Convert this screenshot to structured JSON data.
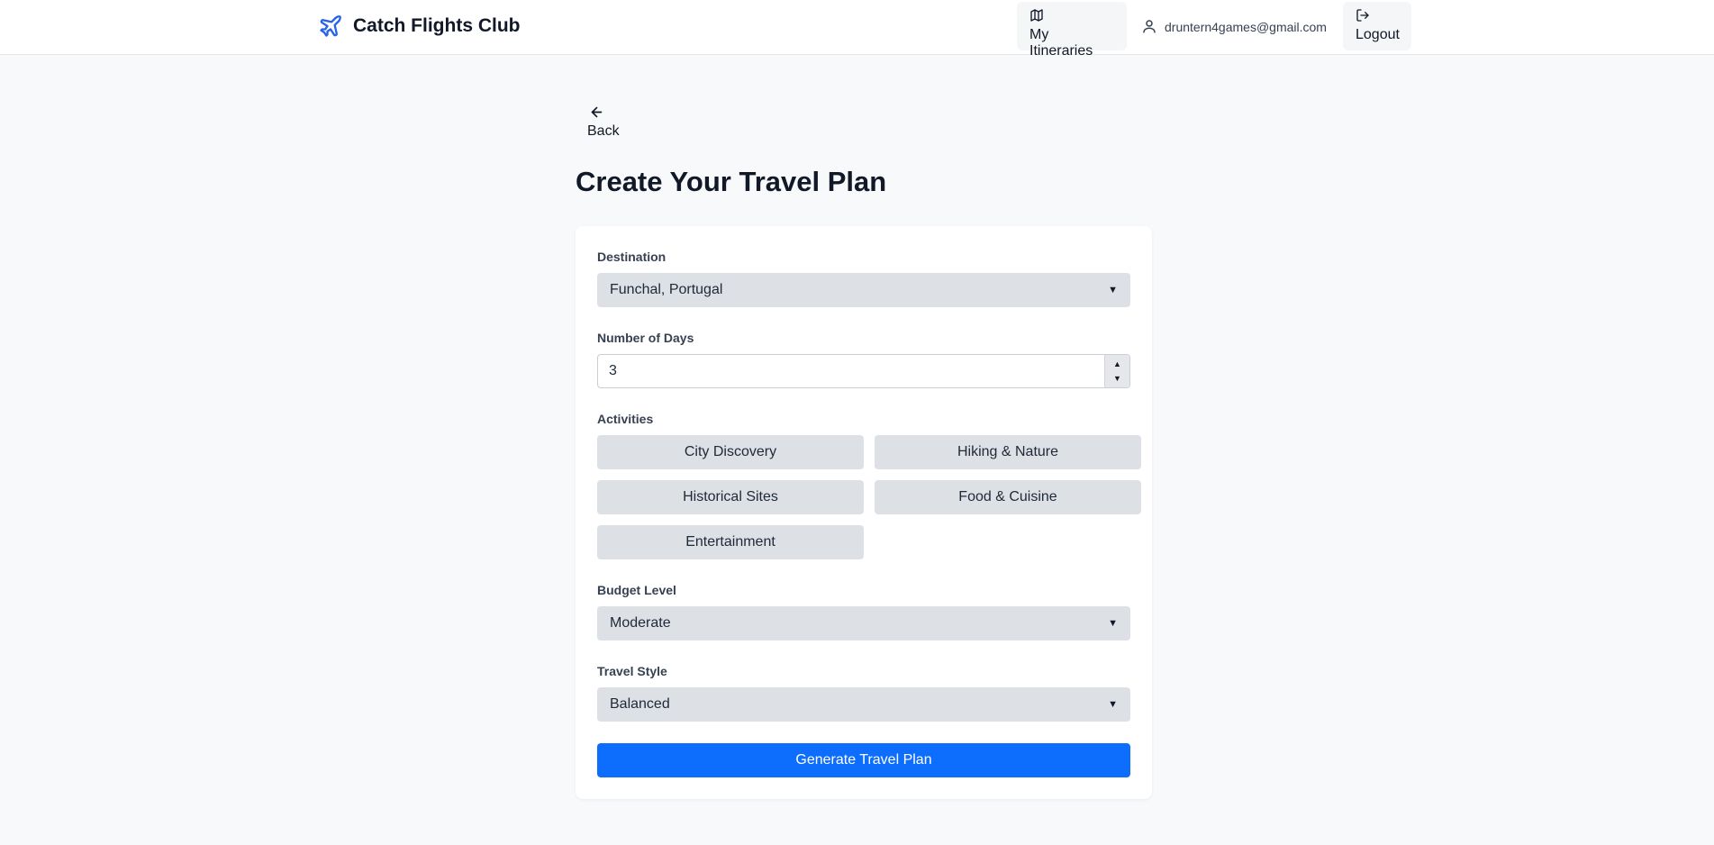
{
  "header": {
    "brand_name": "Catch Flights Club",
    "brand_icon": "plane-icon",
    "itineraries_label": "My Itineraries",
    "itineraries_icon": "map-icon",
    "user_email": "druntern4games@gmail.com",
    "user_icon": "user-icon",
    "logout_label": "Logout",
    "logout_icon": "logout-icon"
  },
  "back": {
    "label": "Back",
    "icon": "arrow-left-icon"
  },
  "page_title": "Create Your Travel Plan",
  "form": {
    "destination": {
      "label": "Destination",
      "value": "Funchal, Portugal"
    },
    "days": {
      "label": "Number of Days",
      "value": "3"
    },
    "activities": {
      "label": "Activities",
      "options": [
        "City Discovery",
        "Hiking & Nature",
        "Historical Sites",
        "Food & Cuisine",
        "Entertainment"
      ]
    },
    "budget": {
      "label": "Budget Level",
      "value": "Moderate"
    },
    "style": {
      "label": "Travel Style",
      "value": "Balanced"
    },
    "submit_label": "Generate Travel Plan"
  },
  "colors": {
    "accent": "#0d6efd",
    "brand_icon": "#2563eb",
    "page_bg": "#f8f9fb",
    "control_bg": "#dde0e5"
  }
}
